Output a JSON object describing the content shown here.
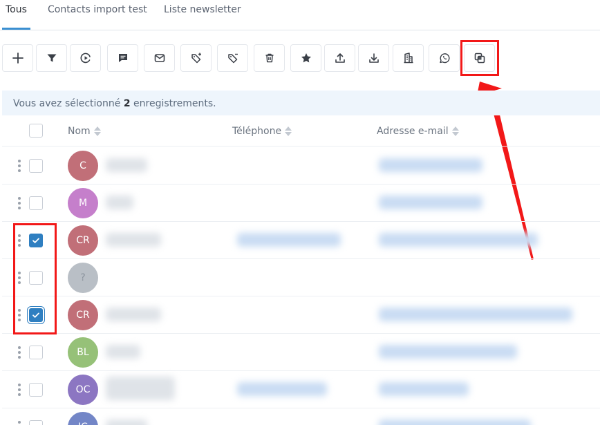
{
  "tabs": [
    {
      "label": "Tous",
      "active": true
    },
    {
      "label": "Contacts import test",
      "active": false
    },
    {
      "label": "Liste newsletter",
      "active": false
    }
  ],
  "toolbar": {
    "buttons": [
      {
        "name": "add-button",
        "icon": "plus-icon"
      },
      {
        "name": "filter-button",
        "icon": "filter-icon"
      },
      {
        "name": "automation-button",
        "icon": "play-circle-icon"
      },
      {
        "name": "sms-button",
        "icon": "message-icon"
      },
      {
        "name": "email-button",
        "icon": "envelope-icon"
      },
      {
        "name": "add-tag-button",
        "icon": "tag-plus-icon"
      },
      {
        "name": "remove-tag-button",
        "icon": "tag-minus-icon"
      },
      {
        "name": "delete-button",
        "icon": "trash-icon"
      },
      {
        "name": "favorite-button",
        "icon": "star-icon"
      },
      {
        "name": "export-button",
        "icon": "upload-icon"
      },
      {
        "name": "import-button",
        "icon": "download-icon"
      },
      {
        "name": "company-button",
        "icon": "building-icon"
      },
      {
        "name": "whatsapp-button",
        "icon": "whatsapp-icon"
      },
      {
        "name": "merge-button",
        "icon": "merge-icon"
      }
    ]
  },
  "banner": {
    "prefix": "Vous avez sélectionné",
    "count": "2",
    "suffix": "enregistrements."
  },
  "table": {
    "columns": [
      "Nom",
      "Téléphone",
      "Adresse e-mail"
    ],
    "rows": [
      {
        "initials": "C",
        "color": "#c16f78",
        "checked": false
      },
      {
        "initials": "M",
        "color": "#c57fcb",
        "checked": false
      },
      {
        "initials": "CR",
        "color": "#c16f78",
        "checked": true
      },
      {
        "initials": "?",
        "color": "#b9bfc6",
        "checked": false
      },
      {
        "initials": "CR",
        "color": "#c16f78",
        "checked": true
      },
      {
        "initials": "BL",
        "color": "#96c178",
        "checked": false
      },
      {
        "initials": "OC",
        "color": "#8c76c2",
        "checked": false
      },
      {
        "initials": "JC",
        "color": "#7386c7",
        "checked": false
      }
    ]
  },
  "colors": {
    "accent": "#3a8fd1",
    "checkbox_checked": "#2f7fc1",
    "annotation_red": "#f21818"
  }
}
